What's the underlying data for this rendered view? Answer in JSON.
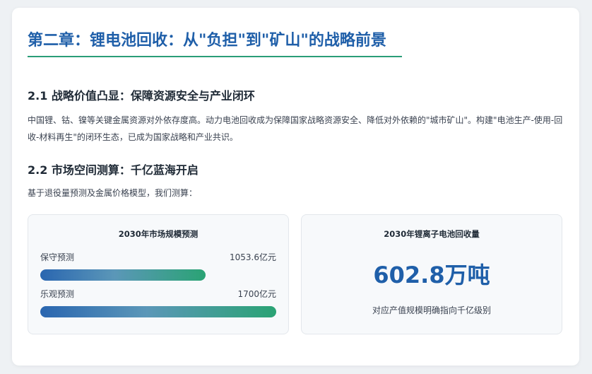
{
  "chapter": {
    "title": "第二章：锂电池回收：从\"负担\"到\"矿山\"的战略前景"
  },
  "section1": {
    "title": "2.1 战略价值凸显：保障资源安全与产业闭环",
    "body": "中国锂、钴、镍等关键金属资源对外依存度高。动力电池回收成为保障国家战略资源安全、降低对外依赖的\"城市矿山\"。构建\"电池生产-使用-回收-材料再生\"的闭环生态，已成为国家战略和产业共识。"
  },
  "section2": {
    "title": "2.2 市场空间测算：千亿蓝海开启",
    "intro": "基于退役量预测及金属价格模型，我们测算："
  },
  "market_panel": {
    "title": "2030年市场规模预测",
    "rows": [
      {
        "label": "保守预测",
        "value_text": "1053.6亿元",
        "value": 1053.6,
        "fraction": 0.7
      },
      {
        "label": "乐观预测",
        "value_text": "1700亿元",
        "value": 1700,
        "fraction": 1.0
      }
    ]
  },
  "recycle_panel": {
    "title": "2030年锂离子电池回收量",
    "big_value": "602.8万吨",
    "note": "对应产值规模明确指向千亿级别"
  },
  "colors": {
    "title_blue": "#1f5fa9",
    "underline_green": "#2a9d78",
    "bar_start": "#2a66b0",
    "bar_end": "#2aa374"
  }
}
